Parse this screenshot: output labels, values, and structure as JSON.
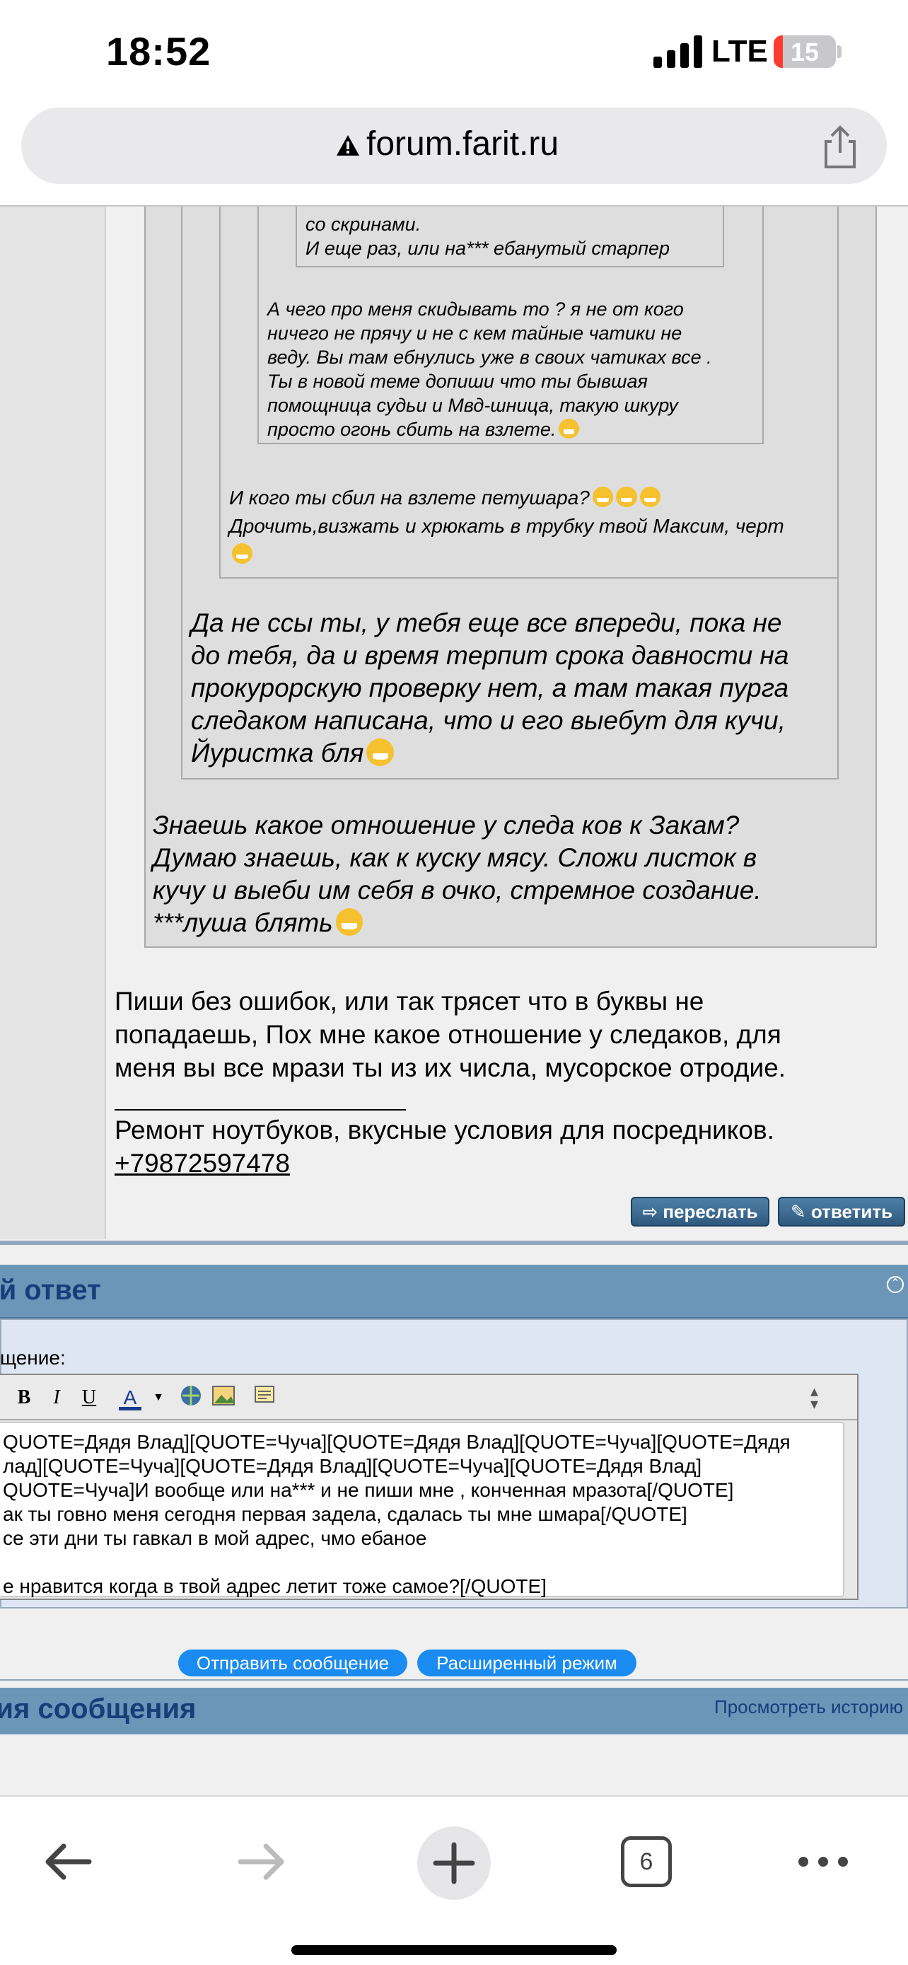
{
  "status": {
    "time": "18:52",
    "network": "LTE",
    "battery": "15",
    "battery_level": 0.15
  },
  "browser": {
    "url": "forum.farit.ru",
    "tabs_count": "6"
  },
  "quotes": {
    "q1_line1": "со скринами.",
    "q1_line2": "И еще раз, или на*** ебанутый старпер",
    "q2_lines": [
      "А чего про меня скидывать то ? я не от кого",
      "ничего не прячу и не с кем тайные чатики не",
      "веду. Вы там ебнулись уже в своих чатиках все .",
      "Ты в новой теме допиши что ты бывшая",
      "помощница судьи и Мвд-шница, такую шкуру",
      "просто огонь сбить на взлете."
    ],
    "q3_line1": "И кого ты сбил на взлете петушара?",
    "q3_line2": "Дрочить,визжать и хрюкать в трубку твой Максим, черт",
    "q4_lines": [
      "Да не ссы ты, у тебя еще все впереди, пока не",
      "до тебя, да и время терпит срока давности на",
      "прокурорскую проверку нет, а там такая пурга",
      "следаком написана, что и его выебут для кучи,",
      "Йуристка бля"
    ],
    "q5_lines": [
      "Знаешь какое отношение у следа ков к Закам?",
      "Думаю знаешь, как к куску мясу. Сложи листок в",
      "кучу и выеби им себя в очко, стремное создание.",
      "***луша блять"
    ]
  },
  "post": {
    "lines": [
      "Пиши без ошибок, или так трясет что в буквы не",
      "попадаешь, Пох мне какое отношение у следаков, для",
      "меня вы все мрази ты из их числа, мусорское отродие."
    ],
    "signature": "Ремонт ноутбуков, вкусные условия для посредников.",
    "phone": "+79872597478",
    "forward_label": "переслать",
    "reply_label": "ответить"
  },
  "quick_reply": {
    "title": "рый ответ",
    "label": "щение:",
    "text": "QUOTE=Дядя Влад][QUOTE=Чуча][QUOTE=Дядя Влад][QUOTE=Чуча][QUOTE=Дядя\nлад][QUOTE=Чуча][QUOTE=Дядя Влад][QUOTE=Чуча][QUOTE=Дядя Влад]\nQUOTE=Чуча]И вообще или на*** и не пиши мне , конченная мразота[/QUOTE]\nак ты говно меня сегодня первая задела, сдалась ты мне шмара[/QUOTE]\nсе эти дни ты гавкал в мой адрес, чмо ебаное\n\nе нравится когда в твой адрес летит тоже самое?[/QUOTE]",
    "send_label": "Отправить сообщение",
    "advanced_label": "Расширенный режим"
  },
  "history": {
    "title": "рия сообщения",
    "link": "Просмотреть историю"
  },
  "colors": {
    "accent": "#1a8bf0",
    "header": "#6b96b8",
    "header_text": "#173d7a"
  }
}
